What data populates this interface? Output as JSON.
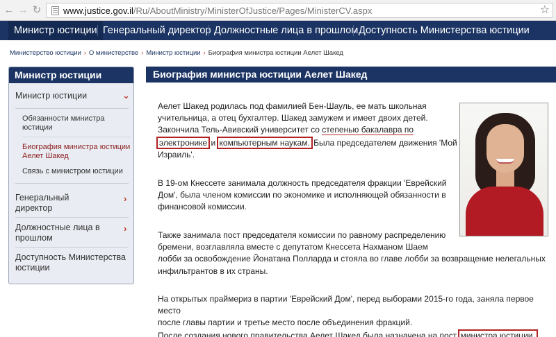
{
  "browser": {
    "url_domain": "www.justice.gov.il",
    "url_path": "/Ru/AboutMinistry/MinisterOfJustice/Pages/MinisterCV.aspx",
    "back_icon": "back-arrow-icon",
    "forward_icon": "forward-arrow-icon",
    "reload_icon": "reload-icon",
    "bookmark_icon": "star-icon"
  },
  "top_nav": {
    "items": [
      {
        "label": "Министр юстиции"
      },
      {
        "label": "Генеральный директор"
      },
      {
        "label": "Должностные лица в прошлом"
      },
      {
        "label": "Доступность Министерства юстиции"
      }
    ]
  },
  "breadcrumb": {
    "items": [
      "Министерство юстиции",
      "О министерстве",
      "Министр юстиции"
    ],
    "current": "Биография министра юстиции Аелет Шакед"
  },
  "sidebar": {
    "title": "Министр юстиции",
    "section": "Министр юстиции",
    "sub_items": [
      {
        "line1": "Обязанности министра",
        "line2": "юстиции"
      },
      {
        "line1": "Биография министра юстиции",
        "line2": "Аелет Шакед"
      },
      {
        "line1": "Связь с министром юстиции",
        "line2": ""
      }
    ],
    "items": [
      {
        "line1": "Генеральный",
        "line2": "директор"
      },
      {
        "line1": "Должностные лица в",
        "line2": "прошлом"
      },
      {
        "line1": "Доступность Министерства",
        "line2": "юстиции"
      }
    ]
  },
  "content": {
    "title": "Биография министра юстиции Аелет Шакед",
    "p1": {
      "l1": "Аелет Шакед родилась под фамилией Бен-Шауль, ее мать школьная",
      "l2": "учительница, а отец бухгалтер. Шакед замужем и имеет двоих детей.",
      "l3a": "Закончила Тель-Авивский университет со ",
      "l3b": "степенью бакалавра по",
      "l4a": "электронике",
      "l4b": " и ",
      "l4c": "компьютерным наукам.",
      "l4d": " Была председателем движения 'Мой",
      "l5": "Израиль'."
    },
    "p2": {
      "l1": "В 19-ом Кнессете занимала должность председателя фракции 'Еврейский",
      "l2": "Дом', была членом комиссии по экономике и исполняющей обязанности в",
      "l3": "финансовой комиссии."
    },
    "p3": {
      "l1": "Также занимала пост председателя комиссии по равному распределению",
      "l2": "бремени, возглавляла вместе с депутатом Кнессета Нахманом Шаем",
      "l3": "лобби за освобождение Йонатана Полларда и стояла во главе лобби за возвращение нелегальных",
      "l4": "инфильтрантов в их страны."
    },
    "p4": {
      "l1": "На открытых праймериз в партии 'Еврейский Дом', перед выборами 2015-го года, заняла первое место",
      "l2": "после главы партии и третье место после объединения фракций.",
      "l3a": "После создания нового правительства Аелет Шакед была назначена на пост ",
      "l3b": "министра юстиции."
    }
  }
}
